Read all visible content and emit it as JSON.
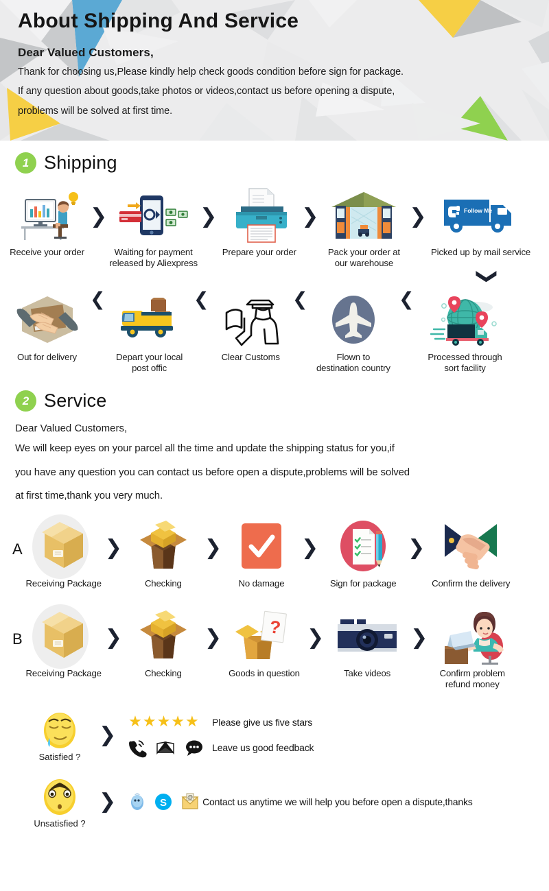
{
  "header": {
    "title": "About Shipping And Service",
    "salutation": "Dear Valued Customers,",
    "line1": "Thank for choosing us,Please kindly help check goods condition before sign for package.",
    "line2": "If any question about goods,take photos or videos,contact us before opening a dispute,",
    "line3": "problems will be solved at first time.",
    "bg_color": "#ececed",
    "accent_blue": "#5ba9d4",
    "accent_yellow": "#f6cf45",
    "accent_green": "#8fd14f",
    "accent_gray": "#b9bbbd"
  },
  "sections": [
    {
      "badge": "1",
      "title": "Shipping"
    },
    {
      "badge": "2",
      "title": "Service"
    }
  ],
  "shipping": {
    "row1": [
      {
        "icon": "desk-worker-icon",
        "label": "Receive your order"
      },
      {
        "icon": "phone-payment-icon",
        "label": "Waiting for payment\nreleased by Aliexpress"
      },
      {
        "icon": "printer-icon",
        "label": "Prepare your order"
      },
      {
        "icon": "warehouse-icon",
        "label": "Pack your order at\nour warehouse"
      },
      {
        "icon": "mail-truck-icon",
        "label": "Picked up by mail service"
      }
    ],
    "row1_separator": "chevron-right-icon",
    "turn_separator": "chevron-down-icon",
    "row2": [
      {
        "icon": "handing-package-icon",
        "label": "Out for delivery"
      },
      {
        "icon": "delivery-van-icon",
        "label": "Depart your local\npost offic"
      },
      {
        "icon": "customs-officer-icon",
        "label": "Clear Customs"
      },
      {
        "icon": "airplane-icon",
        "label": "Flown to\ndestination country"
      },
      {
        "icon": "globe-sort-facility-icon",
        "label": "Processed through\nsort facility"
      }
    ],
    "row2_separator": "chevron-left-icon"
  },
  "service": {
    "salutation": "Dear Valued Customers,",
    "body_line1": "We will keep eyes on your parcel all the time and update the shipping status for you,if",
    "body_line2": "you have any question you can contact us before open a dispute,problems will be solved",
    "body_line3": "at first time,thank you very much.",
    "flow_a_marker": "A",
    "flow_a": [
      {
        "icon": "package-box-icon",
        "label": "Receiving Package"
      },
      {
        "icon": "open-box-icon",
        "label": "Checking"
      },
      {
        "icon": "checkmark-icon",
        "label": "No damage"
      },
      {
        "icon": "clipboard-pencil-icon",
        "label": "Sign for package"
      },
      {
        "icon": "handshake-icon",
        "label": "Confirm the delivery"
      }
    ],
    "flow_b_marker": "B",
    "flow_b": [
      {
        "icon": "package-box-icon",
        "label": "Receiving Package"
      },
      {
        "icon": "open-box-icon",
        "label": "Checking"
      },
      {
        "icon": "question-box-icon",
        "label": "Goods in question"
      },
      {
        "icon": "camera-icon",
        "label": "Take videos"
      },
      {
        "icon": "support-agent-icon",
        "label": "Confirm problem\nrefund money"
      }
    ],
    "separator": "chevron-right-icon"
  },
  "feedback": {
    "satisfied": {
      "emoji": "relieved-face-icon",
      "label": "Satisfied ?",
      "stars": "★★★★★",
      "star_count": 5,
      "stars_text": "Please give us five stars",
      "contact_icons": [
        "phone-icon",
        "envelope-icon",
        "chat-bubble-icon"
      ],
      "contact_text": "Leave us good feedback"
    },
    "unsatisfied": {
      "emoji": "worried-face-icon",
      "label": "Unsatisfied ?",
      "contact_icons": [
        "qq-icon",
        "skype-icon",
        "email-icon"
      ],
      "contact_text": "Contact us anytime we will help you before open a dispute,thanks"
    }
  },
  "colors": {
    "badge_green": "#8fd14f",
    "star_yellow": "#f6c018",
    "chevron_dark": "#1c2230",
    "teal": "#3aa8b8",
    "orange_red": "#ed6a4f",
    "pink_red": "#de4e63",
    "truck_blue": "#1b6fb5",
    "van_yellow": "#f7c51e"
  }
}
